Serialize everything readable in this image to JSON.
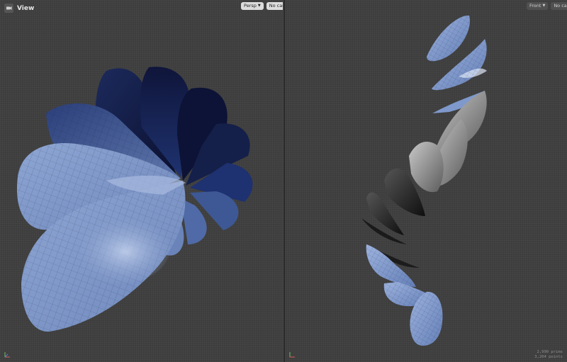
{
  "left_viewport": {
    "title": "View",
    "camera_mode_label": "Persp",
    "camera_label": "No cam",
    "view_icon": "camera-view-icon"
  },
  "right_viewport": {
    "camera_mode_label": "Front",
    "camera_label": "No cam",
    "stats": {
      "prims": "2,990  prims",
      "points": "3,204 points"
    }
  },
  "colors": {
    "viewport_bg": "#3d3d3d",
    "petal_light": "#8da4d0",
    "petal_dark": "#0f1638",
    "petal_grey": "#9a9a9a",
    "button_bg": "#dcdcdc"
  },
  "icons": {
    "dropdown": "chevron-down-icon",
    "axis": "axis-gizmo-icon"
  }
}
